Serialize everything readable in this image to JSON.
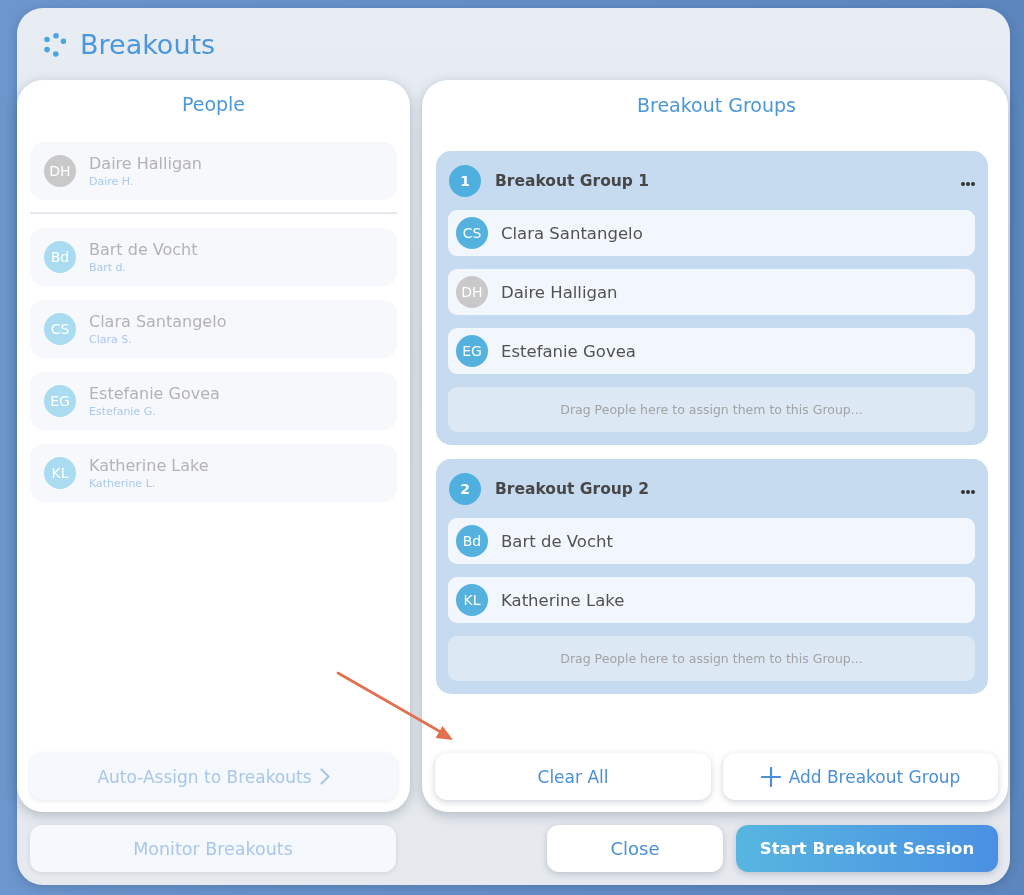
{
  "dialog": {
    "title": "Breakouts"
  },
  "people": {
    "title": "People",
    "sections": [
      {
        "items": [
          {
            "initials": "DH",
            "name": "Daire Halligan",
            "short_name": "Daire H.",
            "color": "#c9c9c9",
            "assigned": true
          }
        ]
      },
      {
        "items": [
          {
            "initials": "Bd",
            "name": "Bart de Vocht",
            "short_name": "Bart d.",
            "color": "#a9dcf1",
            "assigned": true
          },
          {
            "initials": "CS",
            "name": "Clara Santangelo",
            "short_name": "Clara S.",
            "color": "#a9dcf1",
            "assigned": true
          },
          {
            "initials": "EG",
            "name": "Estefanie Govea",
            "short_name": "Estefanie G.",
            "color": "#a9dcf1",
            "assigned": true
          },
          {
            "initials": "KL",
            "name": "Katherine Lake",
            "short_name": "Katherine L.",
            "color": "#a9dcf1",
            "assigned": true
          }
        ]
      }
    ],
    "auto_assign_button": {
      "label": "Auto-Assign to Breakouts",
      "disabled": true
    }
  },
  "groups": {
    "title": "Breakout Groups",
    "items": [
      {
        "number": "1",
        "title": "Breakout Group 1",
        "members": [
          {
            "initials": "CS",
            "name": "Clara Santangelo",
            "color": "#55b1de"
          },
          {
            "initials": "DH",
            "name": "Daire Halligan",
            "color": "#c9c9c9"
          },
          {
            "initials": "EG",
            "name": "Estefanie Govea",
            "color": "#55b1de"
          }
        ],
        "drop_hint": "Drag People here to assign them to this Group..."
      },
      {
        "number": "2",
        "title": "Breakout Group 2",
        "members": [
          {
            "initials": "Bd",
            "name": "Bart de Vocht",
            "color": "#55b1de"
          },
          {
            "initials": "KL",
            "name": "Katherine Lake",
            "color": "#55b1de"
          }
        ],
        "drop_hint": "Drag People here to assign them to this Group..."
      }
    ],
    "clear_button": {
      "label": "Clear All",
      "disabled": false
    },
    "add_button": {
      "label": "Add Breakout Group",
      "disabled": false
    }
  },
  "footer": {
    "monitor_button": {
      "label": "Monitor Breakouts",
      "disabled": true
    },
    "close_button": {
      "label": "Close",
      "disabled": false
    },
    "start_button": {
      "label": "Start Breakout Session",
      "disabled": false
    }
  },
  "annotations": [
    {
      "kind": "arrow"
    }
  ]
}
